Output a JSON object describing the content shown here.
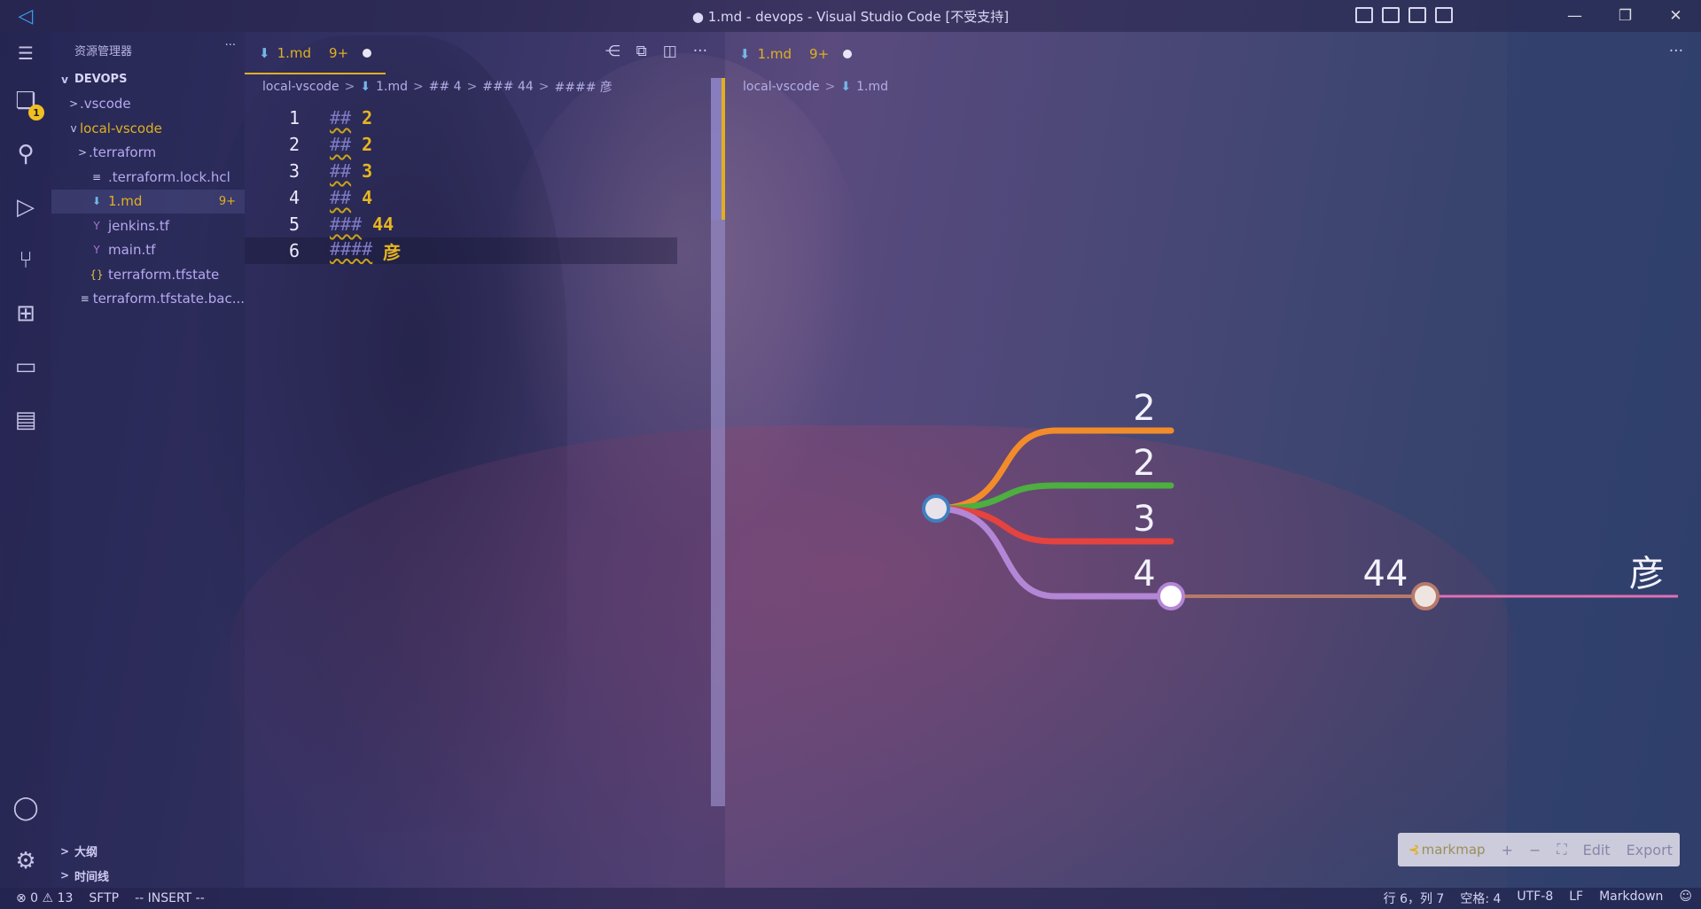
{
  "window": {
    "title": "● 1.md - devops - Visual Studio Code [不受支持]",
    "logo_icon": "vscode-logo-icon"
  },
  "activity_bar": {
    "explorer_badge": "1",
    "items": [
      "files-icon",
      "search-icon",
      "run-debug-icon",
      "source-control-icon",
      "extensions-icon",
      "remote-explorer-icon",
      "notebook-icon"
    ],
    "bottom": [
      "account-icon",
      "settings-gear-icon"
    ]
  },
  "sidebar": {
    "title": "资源管理器",
    "more": "···",
    "root": "DEVOPS",
    "items": [
      {
        "label": ".vscode",
        "chev": ">",
        "icon": "",
        "indent": 1
      },
      {
        "label": "local-vscode",
        "chev": "v",
        "icon": "",
        "indent": 1
      },
      {
        "label": ".terraform",
        "chev": ">",
        "icon": "",
        "indent": 2
      },
      {
        "label": ".terraform.lock.hcl",
        "chev": "",
        "icon": "≡",
        "indent": 2
      },
      {
        "label": "1.md",
        "chev": "",
        "icon": "⬇",
        "indent": 2,
        "count": "9+"
      },
      {
        "label": "jenkins.tf",
        "chev": "",
        "icon": "Y",
        "indent": 2
      },
      {
        "label": "main.tf",
        "chev": "",
        "icon": "Y",
        "indent": 2
      },
      {
        "label": "terraform.tfstate",
        "chev": "",
        "icon": "{}",
        "indent": 2
      },
      {
        "label": "terraform.tfstate.bac...",
        "chev": "",
        "icon": "≡",
        "indent": 2
      }
    ],
    "outline": "大纲",
    "timeline": "时间线"
  },
  "editor": {
    "tab_label": "1.md",
    "tab_count": "9+",
    "breadcrumb": [
      "local-vscode",
      "1.md",
      "## 4",
      "### 44",
      "#### 彦"
    ],
    "lines": [
      {
        "num": "1",
        "hash": "##",
        "val": "2"
      },
      {
        "num": "2",
        "hash": "##",
        "val": "2"
      },
      {
        "num": "3",
        "hash": "##",
        "val": "3"
      },
      {
        "num": "4",
        "hash": "##",
        "val": "4"
      },
      {
        "num": "5",
        "hash": "###",
        "val": "44"
      },
      {
        "num": "6",
        "hash": "####",
        "val": "彦"
      }
    ]
  },
  "preview": {
    "tab_label": "1.md",
    "tab_count": "9+",
    "breadcrumb": [
      "local-vscode",
      "1.md"
    ],
    "mindmap": {
      "branches": [
        {
          "label": "2",
          "color": "#f28c2a"
        },
        {
          "label": "2",
          "color": "#4caf3f"
        },
        {
          "label": "3",
          "color": "#e5433f"
        },
        {
          "label": "4",
          "color": "#b486d6"
        }
      ],
      "level3": {
        "label": "44",
        "color": "#b77a6a"
      },
      "level4": {
        "label": "彦",
        "color": "#e070b4"
      }
    },
    "toolbar": {
      "brand": "markmap",
      "zoom_in": "+",
      "zoom_out": "−",
      "fit": "⛶",
      "edit": "Edit",
      "export": "Export"
    }
  },
  "statusbar": {
    "errors": "⊗ 0",
    "warnings": "⚠ 13",
    "sftp": "SFTP",
    "mode": "-- INSERT --",
    "position": "行 6，列 7",
    "spaces": "空格: 4",
    "encoding": "UTF-8",
    "eol": "LF",
    "language": "Markdown"
  }
}
